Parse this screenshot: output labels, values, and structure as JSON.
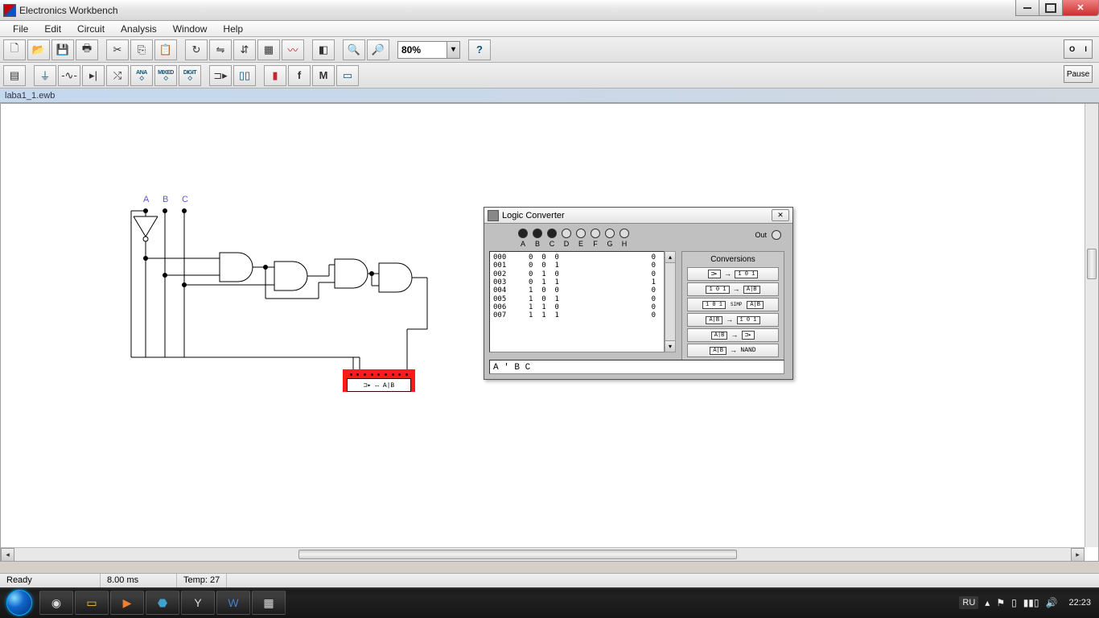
{
  "title": "Electronics Workbench",
  "menu": [
    "File",
    "Edit",
    "Circuit",
    "Analysis",
    "Window",
    "Help"
  ],
  "zoom": "80%",
  "switch_left": "O",
  "switch_right": "I",
  "pause_label": "Pause",
  "doc_name": "laba1_1.ewb",
  "circuit_labels": {
    "a": "A",
    "b": "B",
    "c": "C"
  },
  "instrument_label": "⊐▸ ↔ A|B",
  "logic_converter": {
    "title": "Logic Converter",
    "close": "✕",
    "out_label": "Out",
    "input_labels": [
      "A",
      "B",
      "C",
      "D",
      "E",
      "F",
      "G",
      "H"
    ],
    "active_inputs": [
      true,
      true,
      true,
      false,
      false,
      false,
      false,
      false
    ],
    "rows": [
      {
        "idx": "000",
        "a": "0",
        "b": "0",
        "c": "0",
        "out": "0"
      },
      {
        "idx": "001",
        "a": "0",
        "b": "0",
        "c": "1",
        "out": "0"
      },
      {
        "idx": "002",
        "a": "0",
        "b": "1",
        "c": "0",
        "out": "0"
      },
      {
        "idx": "003",
        "a": "0",
        "b": "1",
        "c": "1",
        "out": "1"
      },
      {
        "idx": "004",
        "a": "1",
        "b": "0",
        "c": "0",
        "out": "0"
      },
      {
        "idx": "005",
        "a": "1",
        "b": "0",
        "c": "1",
        "out": "0"
      },
      {
        "idx": "006",
        "a": "1",
        "b": "1",
        "c": "0",
        "out": "0"
      },
      {
        "idx": "007",
        "a": "1",
        "b": "1",
        "c": "1",
        "out": "0"
      }
    ],
    "conversions_title": "Conversions",
    "buttons": [
      {
        "from": "⊐▸",
        "mid": "→",
        "to": "1 0 1"
      },
      {
        "from": "1 0 1",
        "mid": "→",
        "to": "A|B"
      },
      {
        "from": "1 0 1",
        "mid": "SIMP",
        "to": "A|B"
      },
      {
        "from": "A|B",
        "mid": "→",
        "to": "1 0 1"
      },
      {
        "from": "A|B",
        "mid": "→",
        "to": "⊐▸"
      },
      {
        "from": "A|B",
        "mid": "→",
        "to": "NAND"
      }
    ],
    "expression": "A ' B C"
  },
  "status": {
    "ready": "Ready",
    "time": "8.00 ms",
    "temp": "Temp: 27"
  },
  "taskbar": {
    "lang": "RU",
    "clock": "22:23"
  }
}
